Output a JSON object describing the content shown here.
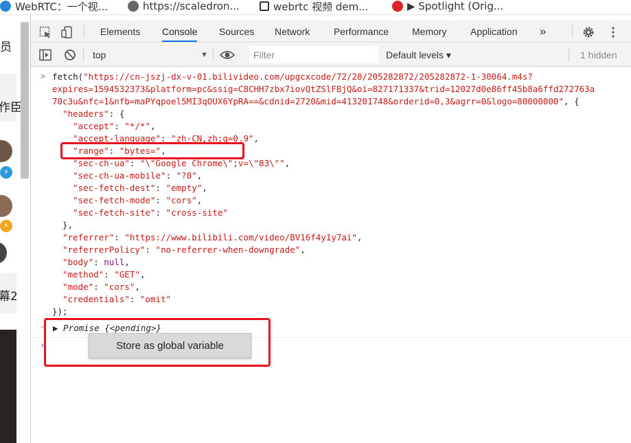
{
  "bookmarks": [
    {
      "label": "WebRTC：一个视...",
      "icon": "webrtc-icon",
      "color": "#2a86d8"
    },
    {
      "label": "https://scaledron...",
      "icon": "globe-icon",
      "color": "#555555"
    },
    {
      "label": "webrtc 视频 dem...",
      "icon": "pen-logo-icon",
      "color": "#333333"
    },
    {
      "label": "▶ Spotlight (Orig...",
      "icon": "netease-music-icon",
      "color": "#e0202a"
    }
  ],
  "page": {
    "text_1": "员",
    "text_2": "作臣",
    "text_3": "幕2"
  },
  "devtools": {
    "tabs": [
      "Elements",
      "Console",
      "Sources",
      "Network",
      "Performance",
      "Memory",
      "Application"
    ],
    "active_tab": "Console",
    "more_tabs": "»",
    "context": "top",
    "filter_placeholder": "Filter",
    "levels": "Default levels ▾",
    "hidden": "1 hidden",
    "accent": "#1a73e8"
  },
  "console": {
    "lines": [
      [
        {
          "c": "p",
          "t": "fetch("
        },
        {
          "c": "s",
          "t": "\"https://cn-jszj-dx-v-01.bilivideo.com/upgcxcode/72/28/205282872/205282872-1-30064.m4s?"
        }
      ],
      [
        {
          "c": "s",
          "t": "expires=1594532373&platform=pc&ssig=C8CHH7zbx7iovQtZSlFBjQ&oi=827171337&trid=12027d0e86ff45b8a6ffd272763a"
        }
      ],
      [
        {
          "c": "s",
          "t": "70c3u&nfc=1&nfb=maPYqpoel5MI3qOUX6YpRA==&cdnid=2720&mid=413201748&orderid=0,3&agrr=0&logo=80000000\""
        },
        {
          "c": "p",
          "t": ", {"
        }
      ],
      [
        {
          "c": "p",
          "t": "  "
        },
        {
          "c": "s",
          "t": "\"headers\""
        },
        {
          "c": "p",
          "t": ": {"
        }
      ],
      [
        {
          "c": "p",
          "t": "    "
        },
        {
          "c": "s",
          "t": "\"accept\""
        },
        {
          "c": "p",
          "t": ": "
        },
        {
          "c": "s",
          "t": "\"*/*\""
        },
        {
          "c": "p",
          "t": ","
        }
      ],
      [
        {
          "c": "p",
          "t": "    "
        },
        {
          "c": "s",
          "t": "\"accept-language\""
        },
        {
          "c": "p",
          "t": ": "
        },
        {
          "c": "s",
          "t": "\"zh-CN,zh;q=0.9\""
        },
        {
          "c": "p",
          "t": ","
        }
      ],
      [
        {
          "c": "p",
          "t": "    "
        },
        {
          "c": "s",
          "t": "\"range\""
        },
        {
          "c": "p",
          "t": ": "
        },
        {
          "c": "s",
          "t": "\"bytes=\""
        },
        {
          "c": "p",
          "t": ","
        }
      ],
      [
        {
          "c": "p",
          "t": "    "
        },
        {
          "c": "s",
          "t": "\"sec-ch-ua\""
        },
        {
          "c": "p",
          "t": ": "
        },
        {
          "c": "s",
          "t": "\"\\\"Google Chrome\\\";v=\\\"83\\\"\""
        },
        {
          "c": "p",
          "t": ","
        }
      ],
      [
        {
          "c": "p",
          "t": "    "
        },
        {
          "c": "s",
          "t": "\"sec-ch-ua-mobile\""
        },
        {
          "c": "p",
          "t": ": "
        },
        {
          "c": "s",
          "t": "\"?0\""
        },
        {
          "c": "p",
          "t": ","
        }
      ],
      [
        {
          "c": "p",
          "t": "    "
        },
        {
          "c": "s",
          "t": "\"sec-fetch-dest\""
        },
        {
          "c": "p",
          "t": ": "
        },
        {
          "c": "s",
          "t": "\"empty\""
        },
        {
          "c": "p",
          "t": ","
        }
      ],
      [
        {
          "c": "p",
          "t": "    "
        },
        {
          "c": "s",
          "t": "\"sec-fetch-mode\""
        },
        {
          "c": "p",
          "t": ": "
        },
        {
          "c": "s",
          "t": "\"cors\""
        },
        {
          "c": "p",
          "t": ","
        }
      ],
      [
        {
          "c": "p",
          "t": "    "
        },
        {
          "c": "s",
          "t": "\"sec-fetch-site\""
        },
        {
          "c": "p",
          "t": ": "
        },
        {
          "c": "s",
          "t": "\"cross-site\""
        }
      ],
      [
        {
          "c": "p",
          "t": "  },"
        }
      ],
      [
        {
          "c": "p",
          "t": "  "
        },
        {
          "c": "s",
          "t": "\"referrer\""
        },
        {
          "c": "p",
          "t": ": "
        },
        {
          "c": "s",
          "t": "\"https://www.bilibili.com/video/BV16f4y1y7ai\""
        },
        {
          "c": "p",
          "t": ","
        }
      ],
      [
        {
          "c": "p",
          "t": "  "
        },
        {
          "c": "s",
          "t": "\"referrerPolicy\""
        },
        {
          "c": "p",
          "t": ": "
        },
        {
          "c": "s",
          "t": "\"no-referrer-when-downgrade\""
        },
        {
          "c": "p",
          "t": ","
        }
      ],
      [
        {
          "c": "p",
          "t": "  "
        },
        {
          "c": "s",
          "t": "\"body\""
        },
        {
          "c": "p",
          "t": ": "
        },
        {
          "c": "k",
          "t": "null"
        },
        {
          "c": "p",
          "t": ","
        }
      ],
      [
        {
          "c": "p",
          "t": "  "
        },
        {
          "c": "s",
          "t": "\"method\""
        },
        {
          "c": "p",
          "t": ": "
        },
        {
          "c": "s",
          "t": "\"GET\""
        },
        {
          "c": "p",
          "t": ","
        }
      ],
      [
        {
          "c": "p",
          "t": "  "
        },
        {
          "c": "s",
          "t": "\"mode\""
        },
        {
          "c": "p",
          "t": ": "
        },
        {
          "c": "s",
          "t": "\"cors\""
        },
        {
          "c": "p",
          "t": ","
        }
      ],
      [
        {
          "c": "p",
          "t": "  "
        },
        {
          "c": "s",
          "t": "\"credentials\""
        },
        {
          "c": "p",
          "t": ": "
        },
        {
          "c": "s",
          "t": "\"omit\""
        }
      ],
      [
        {
          "c": "p",
          "t": "});"
        }
      ]
    ],
    "result": "▶ Promise {<pending>}",
    "context_menu_item": "Store as global variable"
  },
  "annotations": {
    "highlight_color": "#e8101c"
  }
}
